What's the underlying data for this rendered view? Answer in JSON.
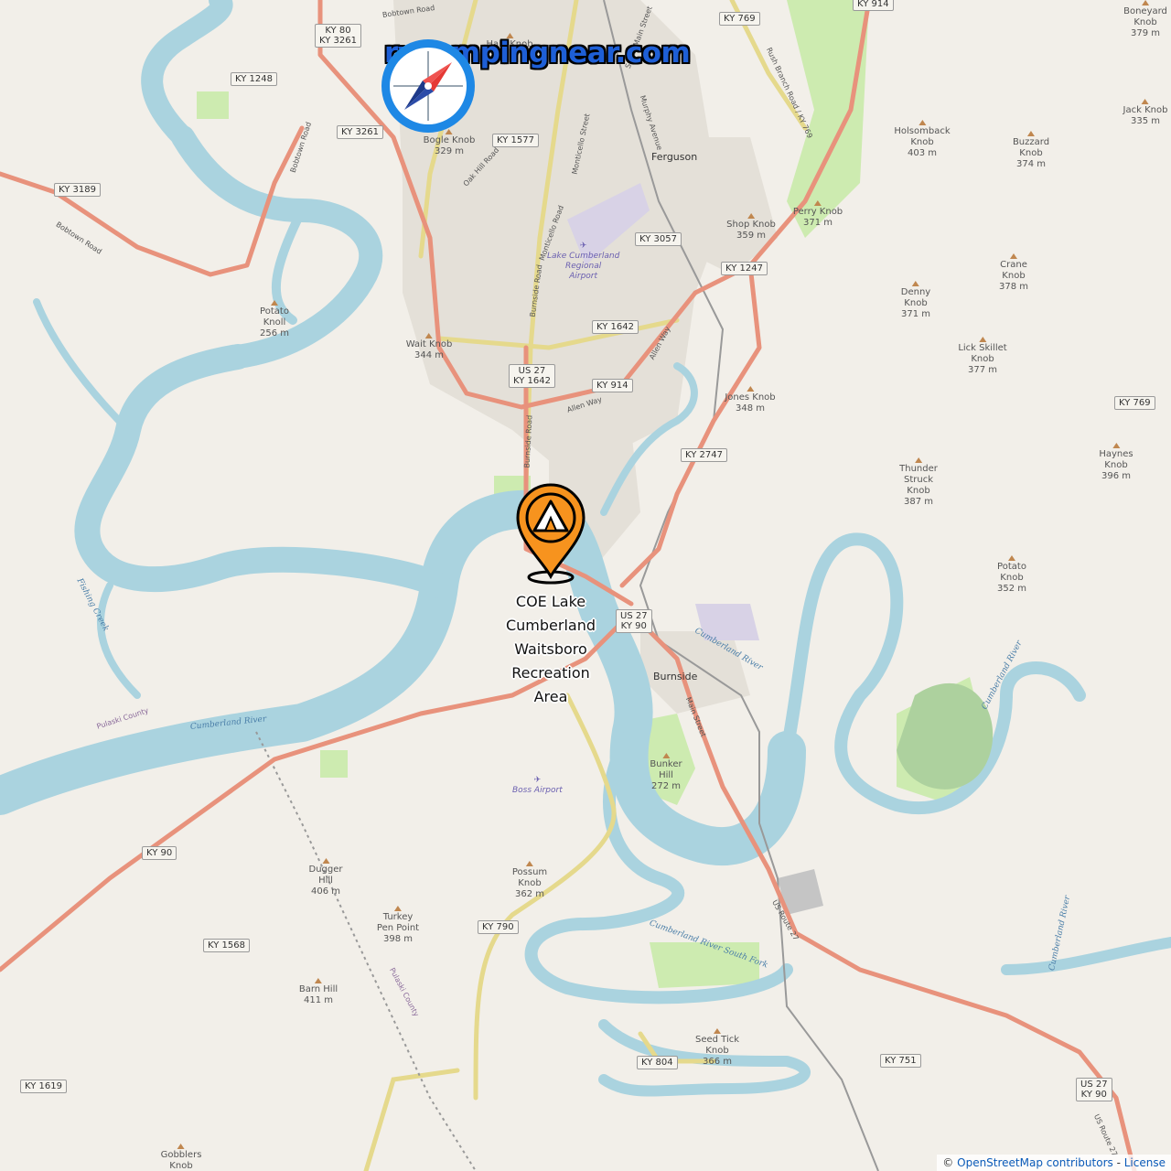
{
  "brand": {
    "site": "rvcampingnear.com",
    "icon": "compass-icon",
    "accent": "#1e88e5"
  },
  "marker": {
    "icon": "campground-pin-icon",
    "color": "#f7931e",
    "label_lines": [
      "COE Lake",
      "Cumberland",
      "Waitsboro",
      "Recreation",
      "Area"
    ]
  },
  "attribution": {
    "prefix": "©",
    "osm": "OpenStreetMap contributors",
    "separator": "-",
    "license": "License"
  },
  "shields": [
    {
      "id": "ky80-3261",
      "text": "KY 80\nKY 3261"
    },
    {
      "id": "ky1248",
      "text": "KY 1248"
    },
    {
      "id": "ky3261",
      "text": "KY 3261"
    },
    {
      "id": "ky3189",
      "text": "KY 3189"
    },
    {
      "id": "ky1577",
      "text": "KY 1577"
    },
    {
      "id": "ky769-top",
      "text": "KY 769"
    },
    {
      "id": "ky914-top",
      "text": "KY 914"
    },
    {
      "id": "ky3057",
      "text": "KY 3057"
    },
    {
      "id": "ky1247",
      "text": "KY 1247"
    },
    {
      "id": "ky1642",
      "text": "KY 1642"
    },
    {
      "id": "us27-ky1642",
      "text": "US 27\nKY 1642"
    },
    {
      "id": "ky914-mid",
      "text": "KY 914"
    },
    {
      "id": "ky2747",
      "text": "KY 2747"
    },
    {
      "id": "ky769-right",
      "text": "KY 769"
    },
    {
      "id": "us27-ky90-mid",
      "text": "US 27\nKY 90"
    },
    {
      "id": "ky90",
      "text": "KY 90"
    },
    {
      "id": "ky1568",
      "text": "KY 1568"
    },
    {
      "id": "ky790",
      "text": "KY 790"
    },
    {
      "id": "ky804",
      "text": "KY 804"
    },
    {
      "id": "ky751",
      "text": "KY 751"
    },
    {
      "id": "ky1619",
      "text": "KY 1619"
    },
    {
      "id": "us27-ky90-bottom",
      "text": "US 27\nKY 90"
    }
  ],
  "peaks": [
    {
      "id": "hale",
      "name": "Hale Knob",
      "elev": ""
    },
    {
      "id": "bogle",
      "name": "Bogle Knob",
      "elev": "329 m"
    },
    {
      "id": "potato-knoll",
      "name": "Potato\nKnoll",
      "elev": "256 m"
    },
    {
      "id": "wait",
      "name": "Wait Knob",
      "elev": "344 m"
    },
    {
      "id": "boneyard",
      "name": "Boneyard\nKnob",
      "elev": "379 m"
    },
    {
      "id": "jack",
      "name": "Jack Knob",
      "elev": "335 m"
    },
    {
      "id": "holsomback",
      "name": "Holsomback\nKnob",
      "elev": "403 m"
    },
    {
      "id": "buzzard",
      "name": "Buzzard\nKnob",
      "elev": "374 m"
    },
    {
      "id": "shop",
      "name": "Shop Knob",
      "elev": "359 m"
    },
    {
      "id": "perry",
      "name": "Perry Knob",
      "elev": "371 m"
    },
    {
      "id": "crane",
      "name": "Crane\nKnob",
      "elev": "378 m"
    },
    {
      "id": "denny",
      "name": "Denny\nKnob",
      "elev": "371 m"
    },
    {
      "id": "lickskillet",
      "name": "Lick Skillet\nKnob",
      "elev": "377 m"
    },
    {
      "id": "jones",
      "name": "Jones Knob",
      "elev": "348 m"
    },
    {
      "id": "haynes",
      "name": "Haynes\nKnob",
      "elev": "396 m"
    },
    {
      "id": "thunder",
      "name": "Thunder\nStruck\nKnob",
      "elev": "387 m"
    },
    {
      "id": "potato-knob",
      "name": "Potato\nKnob",
      "elev": "352 m"
    },
    {
      "id": "bunker",
      "name": "Bunker\nHill",
      "elev": "272 m"
    },
    {
      "id": "dugger",
      "name": "Dugger\nHill",
      "elev": "406 m"
    },
    {
      "id": "possum",
      "name": "Possum\nKnob",
      "elev": "362 m"
    },
    {
      "id": "turkey",
      "name": "Turkey\nPen Point",
      "elev": "398 m"
    },
    {
      "id": "barn",
      "name": "Barn Hill",
      "elev": "411 m"
    },
    {
      "id": "seedtick",
      "name": "Seed Tick\nKnob",
      "elev": "366 m"
    },
    {
      "id": "gobblers",
      "name": "Gobblers\nKnob",
      "elev": ""
    }
  ],
  "places": [
    {
      "id": "ferguson",
      "name": "Ferguson"
    },
    {
      "id": "burnside",
      "name": "Burnside"
    }
  ],
  "airports": [
    {
      "id": "lake-cumberland",
      "name": "Lake Cumberland\nRegional\nAirport"
    },
    {
      "id": "boss",
      "name": "Boss Airport"
    }
  ],
  "road_names": [
    {
      "id": "bobtown-top",
      "name": "Bobtown Road"
    },
    {
      "id": "bobtown-mid",
      "name": "Bobtown Road"
    },
    {
      "id": "bobtown-left",
      "name": "Bobtown Road"
    },
    {
      "id": "south-main",
      "name": "South Main Street"
    },
    {
      "id": "oak-hill",
      "name": "Oak Hill Road"
    },
    {
      "id": "monticello-st",
      "name": "Monticello Street"
    },
    {
      "id": "murphy",
      "name": "Murphy Avenue"
    },
    {
      "id": "monticello-rd",
      "name": "Monticello Road"
    },
    {
      "id": "burnside-rd-top",
      "name": "Burnside Road"
    },
    {
      "id": "burnside-rd-mid",
      "name": "Burnside Road"
    },
    {
      "id": "allen-way-1",
      "name": "Allen Way"
    },
    {
      "id": "allen-way-2",
      "name": "Allen Way"
    },
    {
      "id": "rush-branch",
      "name": "Rush Branch Road / KY 769"
    },
    {
      "id": "main-street",
      "name": "Main Street"
    },
    {
      "id": "us-route-27",
      "name": "US Route 27"
    },
    {
      "id": "us-route-27-b",
      "name": "US Route 27"
    }
  ],
  "water_names": [
    {
      "id": "fishing-creek",
      "name": "Fishing Creek"
    },
    {
      "id": "cumberland-left",
      "name": "Cumberland River"
    },
    {
      "id": "cumberland-mid",
      "name": "Cumberland River"
    },
    {
      "id": "cumberland-right",
      "name": "Cumberland River"
    },
    {
      "id": "cumberland-east",
      "name": "Cumberland River"
    },
    {
      "id": "south-fork",
      "name": "Cumberland River South Fork"
    }
  ],
  "boundaries": [
    {
      "id": "pulaski-county-1",
      "name": "Pulaski County"
    },
    {
      "id": "pulaski-county-2",
      "name": "Pulaski County"
    }
  ],
  "colors": {
    "background": "#f2efe9",
    "water": "#aad3df",
    "primary_road": "#e8927c",
    "secondary_road": "#f7fabf",
    "forest": "#add19e",
    "residential": "#e0dfdf"
  }
}
